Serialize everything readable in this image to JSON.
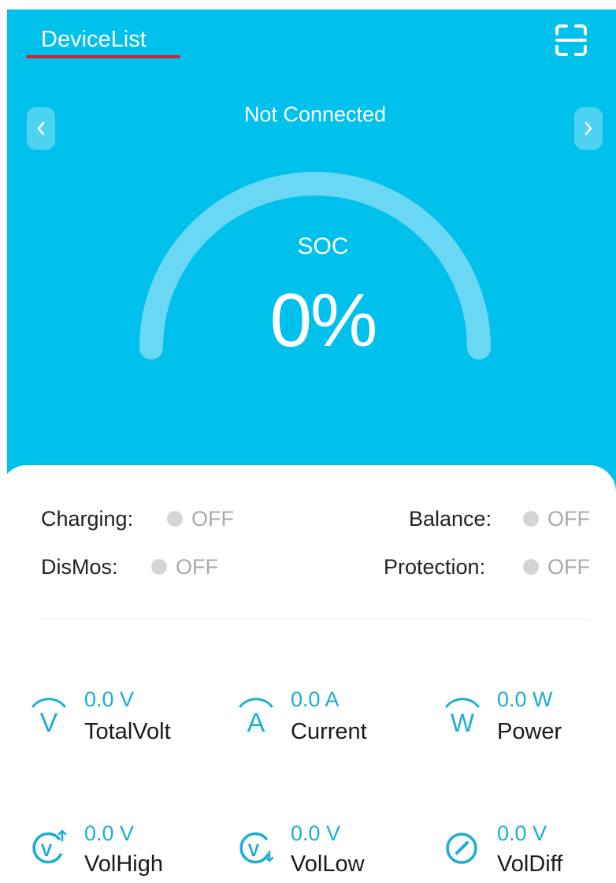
{
  "header": {
    "title": "DeviceList"
  },
  "connection": {
    "status": "Not Connected"
  },
  "soc": {
    "label": "SOC",
    "value": "0%",
    "level": 0
  },
  "statuses": [
    {
      "label": "Charging:",
      "value": "OFF"
    },
    {
      "label": "Balance:",
      "value": "OFF"
    },
    {
      "label": "DisMos:",
      "value": "OFF"
    },
    {
      "label": "Protection:",
      "value": "OFF"
    }
  ],
  "metrics": [
    {
      "value": "0.0 V",
      "label": "TotalVolt",
      "icon": "voltage-icon"
    },
    {
      "value": "0.0 A",
      "label": "Current",
      "icon": "current-icon"
    },
    {
      "value": "0.0 W",
      "label": "Power",
      "icon": "power-icon"
    },
    {
      "value": "0.0 V",
      "label": "VolHigh",
      "icon": "voltage-high-icon"
    },
    {
      "value": "0.0 V",
      "label": "VolLow",
      "icon": "voltage-low-icon"
    },
    {
      "value": "0.0 V",
      "label": "VolDiff",
      "icon": "voltage-diff-icon"
    }
  ],
  "colors": {
    "accent": "#00c1ec",
    "value_text": "#1aaed6",
    "underline": "#c8262e",
    "off_dot": "#d5d5d5"
  }
}
